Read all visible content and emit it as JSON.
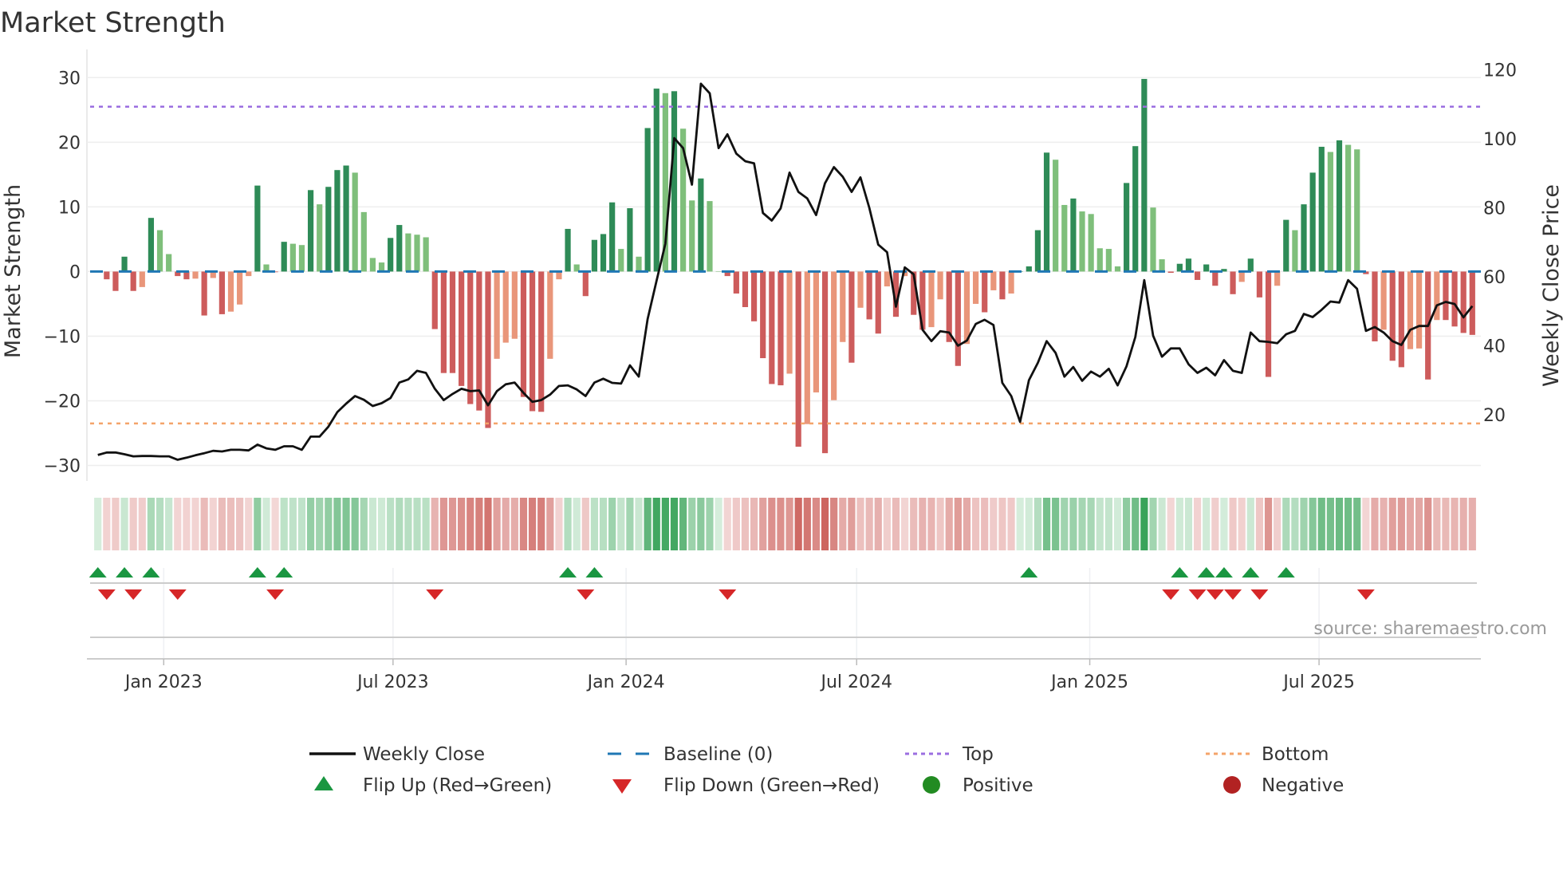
{
  "chart_data": {
    "type": "bar",
    "title": "Market Strength",
    "ylabel": "Market Strength",
    "y2label": "Weekly Close Price",
    "ylim": [
      -32.4,
      33
    ],
    "y2_ticks": [
      "20",
      "40",
      "60",
      "80",
      "100",
      "120"
    ],
    "y2_tick_values": [
      20,
      40,
      60,
      80,
      100,
      120
    ],
    "y_ticks": [
      "30",
      "20",
      "10",
      "0",
      "−10",
      "−20",
      "−30"
    ],
    "y_tick_values": [
      30,
      20,
      10,
      0,
      -10,
      -20,
      -30
    ],
    "start_date": "2022-11-10",
    "frequency": "weekly",
    "x_ticks": [
      {
        "label": "Jan 2023",
        "date": "2023-01-01"
      },
      {
        "label": "Jul 2023",
        "date": "2023-07-01"
      },
      {
        "label": "Jan 2024",
        "date": "2024-01-01"
      },
      {
        "label": "Jul 2024",
        "date": "2024-07-01"
      },
      {
        "label": "Jan 2025",
        "date": "2025-01-01"
      },
      {
        "label": "Jul 2025",
        "date": "2025-07-01"
      }
    ],
    "top_level": 25.5,
    "bottom_level": -23.5,
    "baseline": 0,
    "strength": [
      0.1,
      -1.2,
      -3,
      2.3,
      -3,
      -2.4,
      8.3,
      6.4,
      2.7,
      -0.7,
      -1.2,
      -1.1,
      -6.8,
      -1.0,
      -6.6,
      -6.2,
      -5.1,
      -0.7,
      13.3,
      1.1,
      -0.1,
      4.6,
      4.3,
      4.1,
      12.6,
      10.4,
      13.1,
      15.7,
      16.4,
      15.3,
      9.2,
      2.1,
      1.4,
      5.2,
      7.2,
      5.9,
      5.7,
      5.3,
      -8.9,
      -15.7,
      -15.7,
      -17.7,
      -20.5,
      -21.5,
      -24.2,
      -13.5,
      -11,
      -10.4,
      -19.4,
      -21.6,
      -21.7,
      -13.5,
      -1.2,
      6.6,
      1.1,
      -3.8,
      4.9,
      5.8,
      10.7,
      3.5,
      9.8,
      2.3,
      22.2,
      28.3,
      27.6,
      27.9,
      22.1,
      11.0,
      14.4,
      10.9,
      0,
      -0.7,
      -3.4,
      -5.5,
      -7.7,
      -13.4,
      -17.4,
      -17.6,
      -15.8,
      -27.1,
      -23.6,
      -18.7,
      -28.1,
      -19.9,
      -10.9,
      -14.1,
      -5.6,
      -7.4,
      -9.6,
      -2.3,
      -7.0,
      -0.7,
      -6.7,
      -9.0,
      -8.6,
      -4.3,
      -10.9,
      -14.6,
      -11.2,
      -5.0,
      -6.3,
      -2.9,
      -4.3,
      -3.4,
      0,
      0.8,
      6.4,
      18.4,
      17.3,
      10.3,
      11.3,
      9.3,
      8.9,
      3.6,
      3.5,
      0.8,
      13.7,
      19.4,
      29.8,
      9.9,
      1.9,
      -0.2,
      1.2,
      2.0,
      -1.3,
      1.1,
      -2.2,
      0.4,
      -3.5,
      -1.6,
      2.0,
      -4.0,
      -16.3,
      -2.2,
      8.0,
      6.4,
      10.4,
      15.3,
      19.3,
      18.5,
      20.3,
      19.6,
      18.9,
      -0.4,
      -10.8,
      -9,
      -13.8,
      -14.8,
      -12.0,
      -11.9,
      -16.7,
      -7.5,
      -7.5,
      -8.5,
      -9.5,
      -9.8
    ],
    "weekly_close": [
      8.3,
      9.0,
      9.0,
      8.5,
      7.9,
      8.0,
      8.0,
      7.9,
      7.9,
      6.9,
      7.5,
      8.2,
      8.8,
      9.5,
      9.3,
      9.8,
      9.8,
      9.6,
      11.3,
      10.2,
      9.8,
      10.8,
      10.8,
      9.8,
      13.6,
      13.6,
      16.5,
      20.7,
      23.2,
      25.4,
      24.3,
      22.5,
      23.3,
      24.8,
      29.3,
      30.2,
      32.7,
      32.1,
      27.5,
      24.2,
      26.0,
      27.5,
      26.8,
      27.0,
      22.7,
      26.8,
      28.8,
      29.3,
      26.3,
      23.7,
      24.2,
      25.8,
      28.3,
      28.5,
      27.3,
      25.4,
      29.3,
      30.4,
      29.2,
      29.0,
      34.3,
      31.0,
      47.7,
      58.8,
      69.6,
      100.2,
      97.3,
      86.7,
      116,
      113.2,
      97.3,
      101.3,
      95.7,
      93.5,
      92.9,
      78.5,
      76.3,
      79.8,
      90.2,
      84.6,
      82.7,
      77.9,
      87.1,
      91.8,
      89.0,
      84.6,
      88.8,
      80,
      69.3,
      67.1,
      51.3,
      62.7,
      60.7,
      44.6,
      41.3,
      44.2,
      43.8,
      40,
      41.5,
      46.3,
      47.5,
      46,
      29.2,
      25.4,
      17.9,
      30.0,
      35,
      41.3,
      37.9,
      31,
      33.8,
      29.8,
      32.5,
      31,
      33.3,
      28.5,
      34,
      42.5,
      59,
      42.9,
      36.8,
      39.2,
      39.2,
      34.6,
      32.1,
      33.6,
      31.4,
      35.8,
      32.7,
      32.1,
      43.8,
      41.3,
      41.1,
      40.7,
      43.3,
      44.3,
      49.2,
      48.3,
      50.4,
      52.8,
      52.5,
      59,
      56.5,
      44.3,
      45.4,
      43.8,
      41.3,
      40.2,
      44.6,
      45.7,
      45.7,
      51.7,
      52.7,
      52.1,
      48.2,
      51.5
    ],
    "flip_up_weeks": [
      0,
      3,
      6,
      18,
      21,
      53,
      56,
      105,
      122,
      125,
      127,
      130,
      134
    ],
    "flip_down_weeks": [
      1,
      4,
      9,
      20,
      38,
      55,
      71,
      121,
      124,
      126,
      128,
      131,
      143
    ],
    "legend": [
      {
        "label": "Weekly Close",
        "symbol": "line",
        "color": "#111111"
      },
      {
        "label": "Baseline (0)",
        "symbol": "dash",
        "color": "#1f77b4"
      },
      {
        "label": "Top",
        "symbol": "dot",
        "color": "#9b6ee0"
      },
      {
        "label": "Bottom",
        "symbol": "dot",
        "color": "#f4a46a"
      },
      {
        "label": "Flip Up (Red→Green)",
        "symbol": "triangle-up",
        "color": "#1a9641"
      },
      {
        "label": "Flip Down (Green→Red)",
        "symbol": "triangle-down",
        "color": "#d62728"
      },
      {
        "label": "Positive",
        "symbol": "circle",
        "color": "#228b22"
      },
      {
        "label": "Negative",
        "symbol": "circle",
        "color": "#b22222"
      }
    ],
    "legend_position": "bottom",
    "grid": true,
    "source": "source: sharemaestro.com"
  },
  "colors": {
    "pos_rising": "#2e8b57",
    "pos_falling": "#7fbf7b",
    "neg_falling": "#cd5c5c",
    "neg_rising": "#e9967a"
  }
}
